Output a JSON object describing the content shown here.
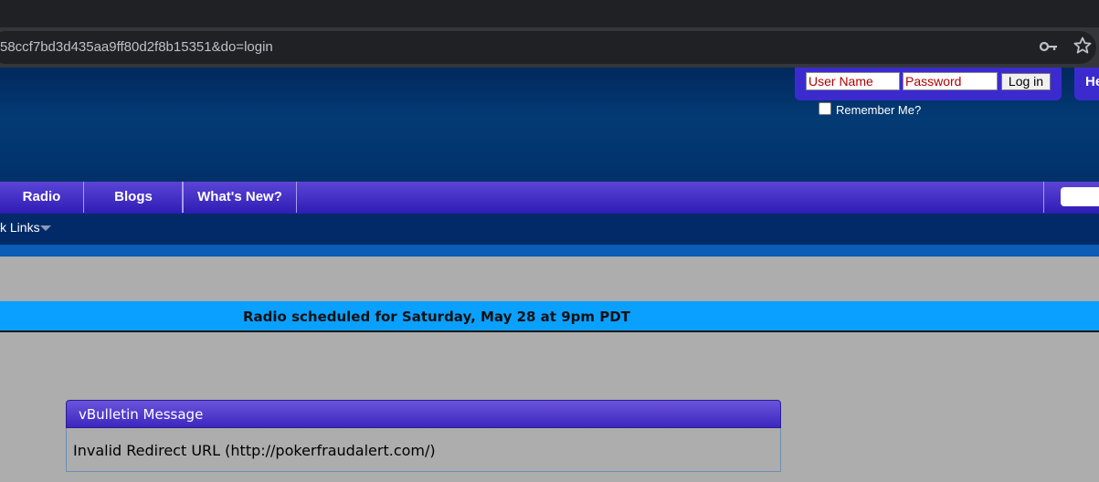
{
  "browser": {
    "url": "58ccf7bd3d435aa9ff80d2f8b15351&do=login"
  },
  "login": {
    "username_placeholder": "User Name",
    "password_placeholder": "Password",
    "login_button": "Log in",
    "remember_label": "Remember Me?"
  },
  "header": {
    "help_label": "He"
  },
  "nav": {
    "tabs": [
      {
        "label": "Radio"
      },
      {
        "label": "Blogs"
      },
      {
        "label": "What's New?"
      }
    ],
    "quick_links": "k Links"
  },
  "announcement": {
    "text": "Radio scheduled for Saturday, May 28 at 9pm PDT"
  },
  "message_box": {
    "title": "vBulletin Message",
    "body": "Invalid Redirect URL (http://pokerfraudalert.com/)"
  },
  "colors": {
    "header_blue": "#023069",
    "nav_purple": "#3b2bcf",
    "announcement_blue": "#0aa0ff",
    "page_gray": "#adadad"
  }
}
